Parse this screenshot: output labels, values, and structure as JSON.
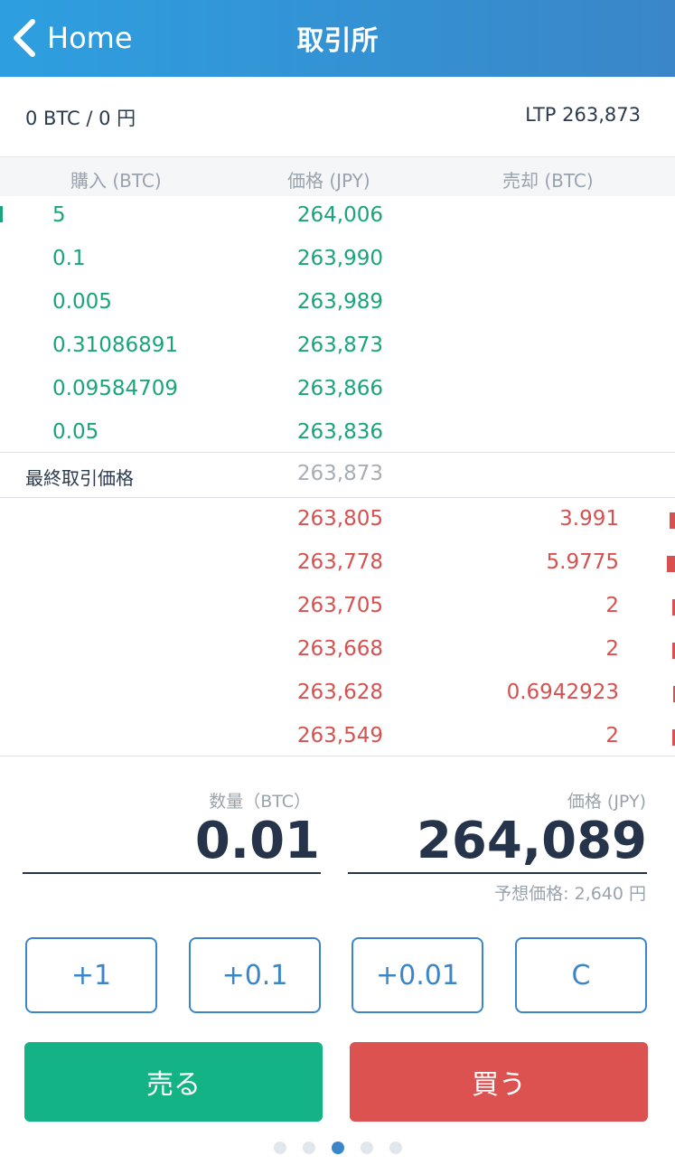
{
  "header": {
    "back_label": "Home",
    "title": "取引所"
  },
  "balance": {
    "text": "0 BTC / 0 円",
    "ltp": "LTP 263,873"
  },
  "orderbook": {
    "headers": {
      "bid": "購入 (BTC)",
      "price": "価格 (JPY)",
      "ask": "売却 (BTC)"
    },
    "bids": [
      {
        "qty": "5",
        "price": "264,006",
        "depth": 0.01
      },
      {
        "qty": "0.1",
        "price": "263,990",
        "depth": 0
      },
      {
        "qty": "0.005",
        "price": "263,989",
        "depth": 0
      },
      {
        "qty": "0.31086891",
        "price": "263,873",
        "depth": 0
      },
      {
        "qty": "0.09584709",
        "price": "263,866",
        "depth": 0
      },
      {
        "qty": "0.05",
        "price": "263,836",
        "depth": 0
      }
    ],
    "last": {
      "label": "最終取引価格",
      "price": "263,873"
    },
    "asks": [
      {
        "price": "263,805",
        "qty": "3.991",
        "depth": 0.67
      },
      {
        "price": "263,778",
        "qty": "5.9775",
        "depth": 1.0
      },
      {
        "price": "263,705",
        "qty": "2",
        "depth": 0.33
      },
      {
        "price": "263,668",
        "qty": "2",
        "depth": 0.33
      },
      {
        "price": "263,628",
        "qty": "0.6942923",
        "depth": 0.12
      },
      {
        "price": "263,549",
        "qty": "2",
        "depth": 0.33
      }
    ]
  },
  "order_form": {
    "qty_label": "数量（BTC）",
    "qty_value": "0.01",
    "price_label": "価格 (JPY)",
    "price_value": "264,089",
    "estimate": "予想価格: 2,640 円"
  },
  "step_buttons": [
    "+1",
    "+0.1",
    "+0.01",
    "C"
  ],
  "actions": {
    "sell": "売る",
    "buy": "買う"
  },
  "pager": {
    "count": 5,
    "active": 2
  },
  "colors": {
    "header": "#3a86c8",
    "bid": "#19a57c",
    "ask": "#d6514f",
    "sell": "#13b386",
    "buy": "#dc5250"
  }
}
